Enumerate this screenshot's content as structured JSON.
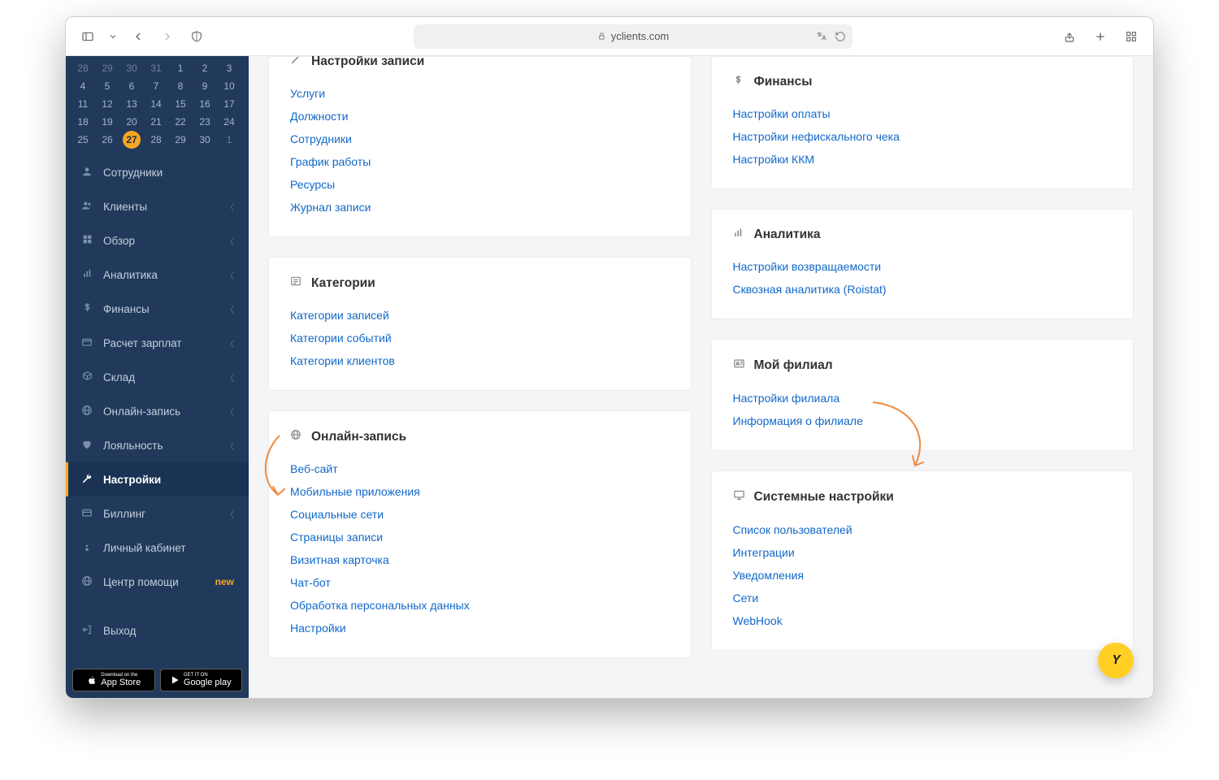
{
  "browser": {
    "url_host": "yclients.com"
  },
  "calendar": {
    "rows": [
      [
        "28",
        "29",
        "30",
        "31",
        "1",
        "2",
        "3"
      ],
      [
        "4",
        "5",
        "6",
        "7",
        "8",
        "9",
        "10"
      ],
      [
        "11",
        "12",
        "13",
        "14",
        "15",
        "16",
        "17"
      ],
      [
        "18",
        "19",
        "20",
        "21",
        "22",
        "23",
        "24"
      ],
      [
        "25",
        "26",
        "27",
        "28",
        "29",
        "30",
        "1"
      ]
    ],
    "selected": "27",
    "current_month_start_row": 0,
    "current_month_start_col": 4,
    "current_month_end_row": 4,
    "current_month_end_col": 5
  },
  "sidebar": {
    "items": [
      {
        "icon": "user",
        "label": "Сотрудники",
        "expandable": false
      },
      {
        "icon": "users",
        "label": "Клиенты",
        "expandable": true
      },
      {
        "icon": "grid",
        "label": "Обзор",
        "expandable": true
      },
      {
        "icon": "chart",
        "label": "Аналитика",
        "expandable": true
      },
      {
        "icon": "dollar",
        "label": "Финансы",
        "expandable": true
      },
      {
        "icon": "card",
        "label": "Расчет зарплат",
        "expandable": true
      },
      {
        "icon": "box",
        "label": "Склад",
        "expandable": true
      },
      {
        "icon": "globe",
        "label": "Онлайн-запись",
        "expandable": true
      },
      {
        "icon": "heart",
        "label": "Лояльность",
        "expandable": true
      },
      {
        "icon": "wrench",
        "label": "Настройки",
        "expandable": false,
        "active": true
      },
      {
        "icon": "credit",
        "label": "Биллинг",
        "expandable": true
      },
      {
        "icon": "person",
        "label": "Личный кабинет",
        "expandable": false
      },
      {
        "icon": "globe",
        "label": "Центр помощи",
        "expandable": false,
        "badge": "new"
      },
      {
        "icon": "exit",
        "label": "Выход",
        "expandable": false
      }
    ]
  },
  "store": {
    "appstore_top": "Download on the",
    "appstore": "App Store",
    "google_top": "GET IT ON",
    "google": "Google play"
  },
  "cards_left": [
    {
      "icon": "pencil",
      "title": "Настройки записи",
      "cut_top": true,
      "links": [
        "Услуги",
        "Должности",
        "Сотрудники",
        "График работы",
        "Ресурсы",
        "Журнал записи"
      ]
    },
    {
      "icon": "list",
      "title": "Категории",
      "links": [
        "Категории записей",
        "Категории событий",
        "Категории клиентов"
      ]
    },
    {
      "icon": "globe",
      "title": "Онлайн-запись",
      "links": [
        "Веб-сайт",
        "Мобильные приложения",
        "Социальные сети",
        "Страницы записи",
        "Визитная карточка",
        "Чат-бот",
        "Обработка персональных данных",
        "Настройки"
      ]
    }
  ],
  "cards_right": [
    {
      "icon": "dollar",
      "title": "Финансы",
      "links": [
        "Настройки оплаты",
        "Настройки нефискального чека",
        "Настройки ККМ"
      ]
    },
    {
      "icon": "chart",
      "title": "Аналитика",
      "links": [
        "Настройки возвращаемости",
        "Сквозная аналитика (Roistat)"
      ]
    },
    {
      "icon": "id",
      "title": "Мой филиал",
      "links": [
        "Настройки филиала",
        "Информация о филиале"
      ]
    },
    {
      "icon": "monitor",
      "title": "Системные настройки",
      "links": [
        "Список пользователей",
        "Интеграции",
        "Уведомления",
        "Сети",
        "WebHook"
      ]
    }
  ],
  "fab": "Y"
}
